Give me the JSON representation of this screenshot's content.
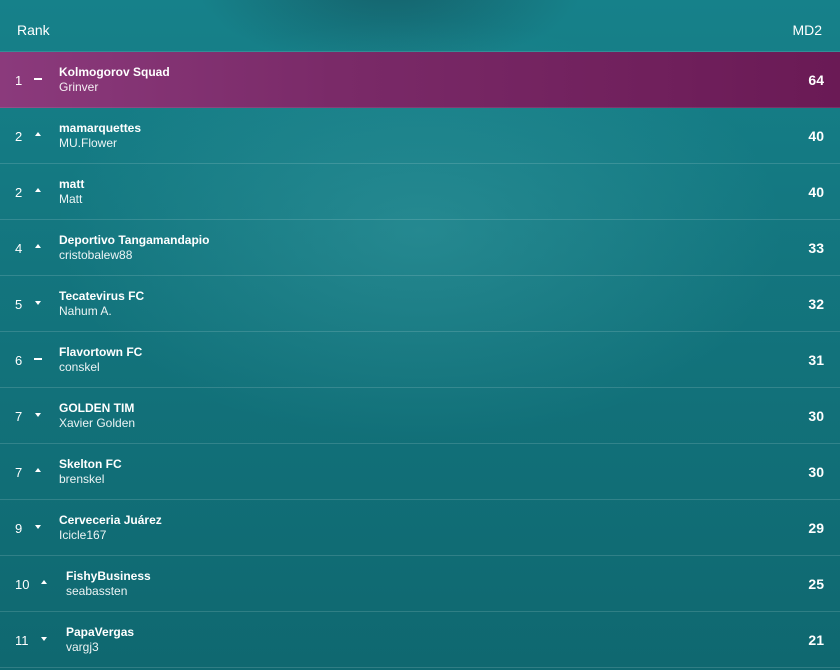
{
  "header": {
    "rank_label": "Rank",
    "score_label": "MD2"
  },
  "rows": [
    {
      "pos": "1",
      "move": "same",
      "team": "Kolmogorov Squad",
      "manager": "Grinver",
      "points": "64"
    },
    {
      "pos": "2",
      "move": "up",
      "team": "mamarquettes",
      "manager": "MU.Flower",
      "points": "40"
    },
    {
      "pos": "2",
      "move": "up",
      "team": "matt",
      "manager": "Matt",
      "points": "40"
    },
    {
      "pos": "4",
      "move": "up",
      "team": "Deportivo Tangamandapio",
      "manager": "cristobalew88",
      "points": "33"
    },
    {
      "pos": "5",
      "move": "down",
      "team": "Tecatevirus FC",
      "manager": "Nahum A.",
      "points": "32"
    },
    {
      "pos": "6",
      "move": "same",
      "team": "Flavortown FC",
      "manager": "conskel",
      "points": "31"
    },
    {
      "pos": "7",
      "move": "down",
      "team": "GOLDEN TIM",
      "manager": "Xavier Golden",
      "points": "30"
    },
    {
      "pos": "7",
      "move": "up",
      "team": "Skelton FC",
      "manager": "brenskel",
      "points": "30"
    },
    {
      "pos": "9",
      "move": "down",
      "team": "Cerveceria Juárez",
      "manager": "Icicle167",
      "points": "29"
    },
    {
      "pos": "10",
      "move": "up",
      "team": "FishyBusiness",
      "manager": "seabassten",
      "points": "25"
    },
    {
      "pos": "11",
      "move": "down",
      "team": "PapaVergas",
      "manager": "vargj3",
      "points": "21"
    }
  ]
}
